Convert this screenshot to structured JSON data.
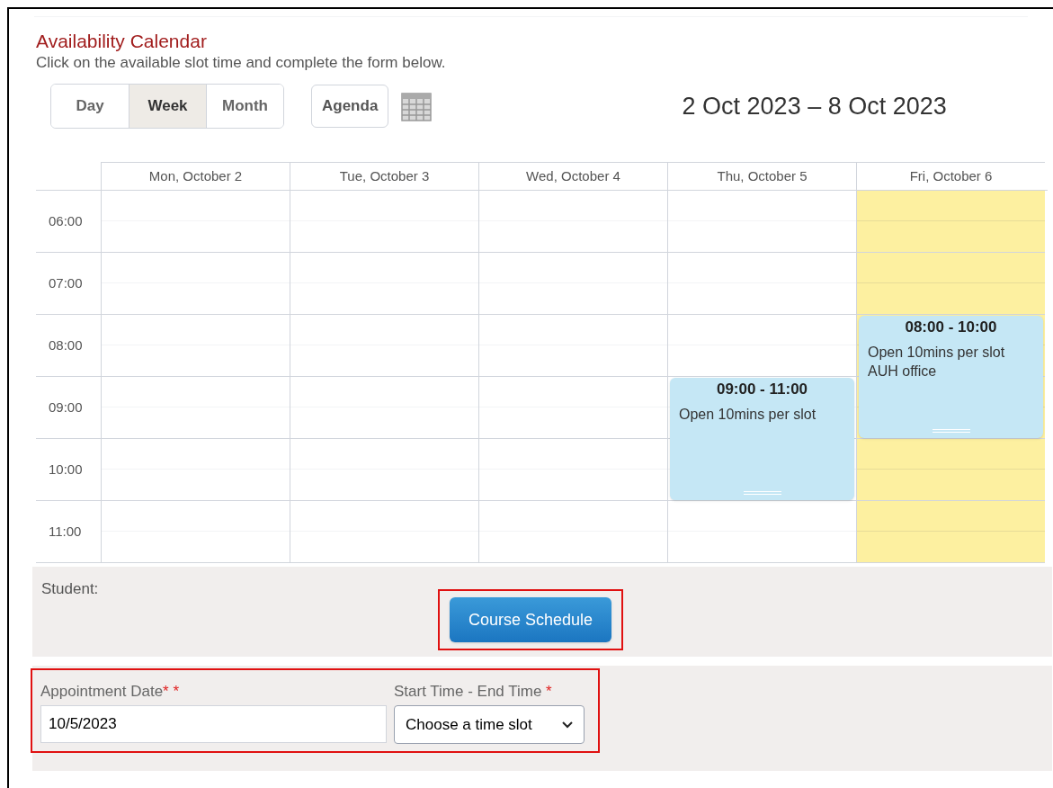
{
  "title": "Availability Calendar",
  "instruction": "Click on the available slot time and complete the form below.",
  "view_buttons": [
    {
      "label": "Day",
      "selected": false
    },
    {
      "label": "Week",
      "selected": true
    },
    {
      "label": "Month",
      "selected": false
    }
  ],
  "agenda_button": "Agenda",
  "date_range": "2 Oct 2023 – 8 Oct 2023",
  "hours": [
    "06:00",
    "07:00",
    "08:00",
    "09:00",
    "10:00",
    "11:00"
  ],
  "days": [
    {
      "label": "Mon, October 2",
      "highlighted": false
    },
    {
      "label": "Tue, October 3",
      "highlighted": false
    },
    {
      "label": "Wed, October 4",
      "highlighted": false
    },
    {
      "label": "Thu, October 5",
      "highlighted": false,
      "events": [
        {
          "time": "09:00 - 11:00",
          "lines": [
            "Open 10mins per slot"
          ]
        }
      ]
    },
    {
      "label": "Fri, October 6",
      "highlighted": true,
      "events": [
        {
          "time": "08:00 - 10:00",
          "lines": [
            "Open 10mins per slot",
            "AUH office"
          ]
        }
      ]
    }
  ],
  "student": {
    "label": "Student:",
    "button": "Course Schedule"
  },
  "form": {
    "date_label": "Appointment Date",
    "date_marks": "* *",
    "date_value": "10/5/2023",
    "time_label": "Start Time - End Time",
    "time_marks": "*",
    "time_value": "Choose a time slot"
  }
}
